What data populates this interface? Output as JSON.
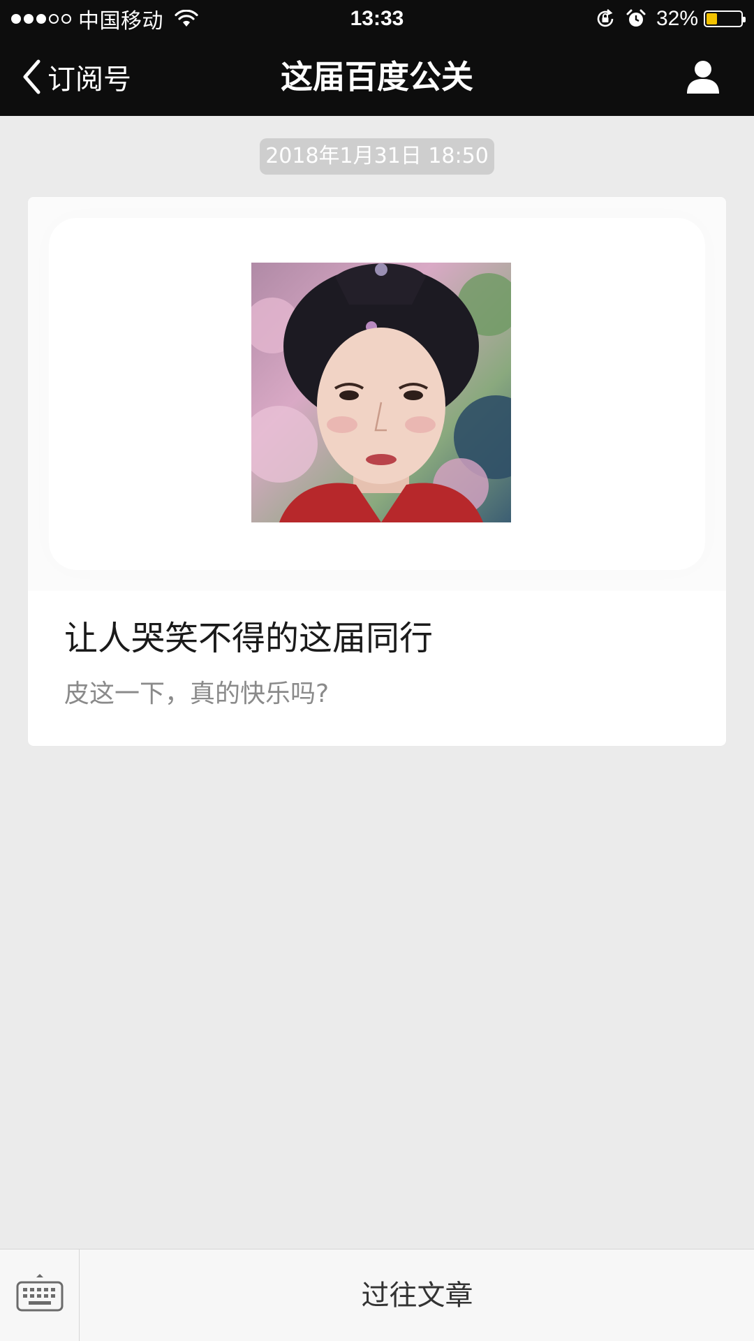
{
  "status_bar": {
    "signal_dots_filled": 3,
    "signal_dots_total": 5,
    "carrier": "中国移动",
    "time": "13:33",
    "battery_percent_label": "32%",
    "battery_level": 0.32,
    "battery_fill_color": "#f2c200",
    "icons": [
      "wifi-icon",
      "orientation-lock-icon",
      "alarm-icon",
      "battery-icon"
    ]
  },
  "nav": {
    "back_label": "订阅号",
    "title": "这届百度公关",
    "icons": [
      "chevron-left-icon",
      "person-icon"
    ]
  },
  "chat": {
    "timestamp": "2018年1月31日 18:50"
  },
  "article": {
    "title": "让人哭笑不得的这届同行",
    "description": "皮这一下，真的快乐吗?"
  },
  "bottom_bar": {
    "history_label": "过往文章",
    "icons": [
      "keyboard-icon"
    ]
  },
  "colors": {
    "bar_background": "#0d0d0d",
    "page_background": "#ebebeb",
    "timestamp_background": "#cecece"
  }
}
